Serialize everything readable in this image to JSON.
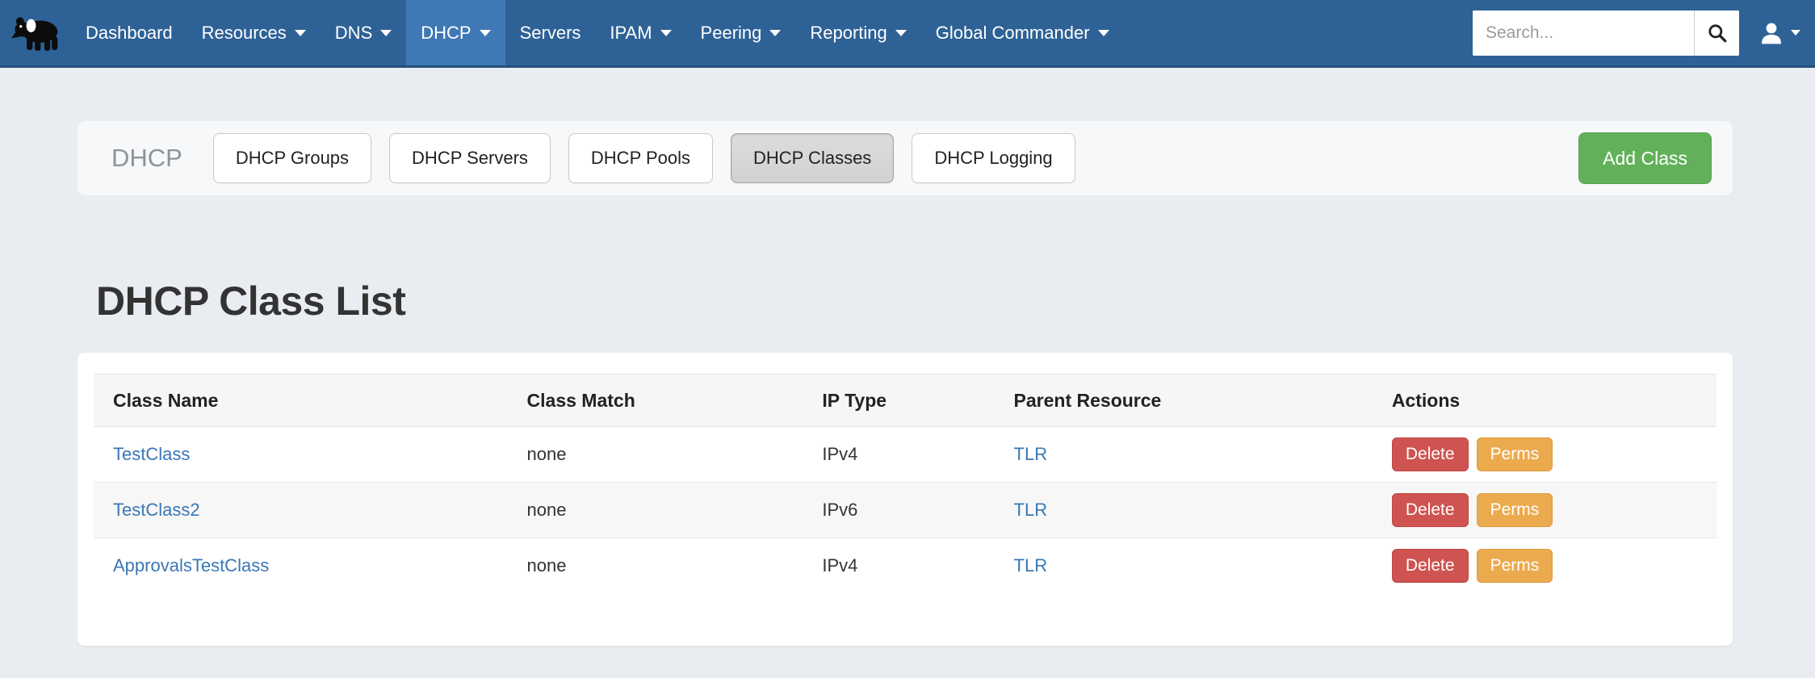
{
  "navbar": {
    "brand_icon": "panda-logo",
    "items": [
      {
        "label": "Dashboard",
        "caret": false,
        "active": false
      },
      {
        "label": "Resources",
        "caret": true,
        "active": false
      },
      {
        "label": "DNS",
        "caret": true,
        "active": false
      },
      {
        "label": "DHCP",
        "caret": true,
        "active": true
      },
      {
        "label": "Servers",
        "caret": false,
        "active": false
      },
      {
        "label": "IPAM",
        "caret": true,
        "active": false
      },
      {
        "label": "Peering",
        "caret": true,
        "active": false
      },
      {
        "label": "Reporting",
        "caret": true,
        "active": false
      },
      {
        "label": "Global Commander",
        "caret": true,
        "active": false
      }
    ],
    "search": {
      "placeholder": "Search...",
      "value": ""
    },
    "colors": {
      "background": "#2e6296",
      "active_item": "#3f78b4"
    }
  },
  "toolbar": {
    "section_title": "DHCP",
    "tabs": [
      {
        "label": "DHCP Groups",
        "active": false
      },
      {
        "label": "DHCP Servers",
        "active": false
      },
      {
        "label": "DHCP Pools",
        "active": false
      },
      {
        "label": "DHCP Classes",
        "active": true
      },
      {
        "label": "DHCP Logging",
        "active": false
      }
    ],
    "add_button": "Add Class",
    "add_button_color": "#62b15a"
  },
  "page": {
    "title": "DHCP Class List"
  },
  "table": {
    "headers": [
      "Class Name",
      "Class Match",
      "IP Type",
      "Parent Resource",
      "Actions"
    ],
    "rows": [
      {
        "class_name": "TestClass",
        "class_match": "none",
        "ip_type": "IPv4",
        "parent_resource": "TLR",
        "actions": [
          {
            "label": "Delete",
            "style": "danger"
          },
          {
            "label": "Perms",
            "style": "warning"
          }
        ]
      },
      {
        "class_name": "TestClass2",
        "class_match": "none",
        "ip_type": "IPv6",
        "parent_resource": "TLR",
        "actions": [
          {
            "label": "Delete",
            "style": "danger"
          },
          {
            "label": "Perms",
            "style": "warning"
          }
        ]
      },
      {
        "class_name": "ApprovalsTestClass",
        "class_match": "none",
        "ip_type": "IPv4",
        "parent_resource": "TLR",
        "actions": [
          {
            "label": "Delete",
            "style": "danger"
          },
          {
            "label": "Perms",
            "style": "warning"
          }
        ]
      }
    ],
    "colors": {
      "link": "#3a77b5",
      "delete_button": "#cf5350",
      "perms_button": "#ecaa4e"
    }
  }
}
